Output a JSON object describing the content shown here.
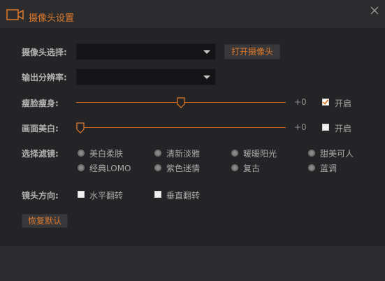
{
  "window": {
    "title": "摄像头设置",
    "accent": "#e07a2c",
    "icons": {
      "camera": "video-camera-icon",
      "close": "close-icon"
    }
  },
  "camera_select": {
    "label": "摄像头选择:",
    "value": "",
    "open_button": "打开摄像头"
  },
  "resolution": {
    "label": "输出分辨率:",
    "value": ""
  },
  "slim_face": {
    "label": "瘦脸瘦身:",
    "value_text": "+0",
    "level": 0.5,
    "enable_label": "开启",
    "enabled": true
  },
  "whitening": {
    "label": "画面美白:",
    "value_text": "+0",
    "level": 0.0,
    "enable_label": "开启",
    "enabled": false
  },
  "filters": {
    "label": "选择滤镜:",
    "options": [
      "美白柔肤",
      "清新淡雅",
      "暖暖阳光",
      "甜美可人",
      "经典LOMO",
      "紫色迷情",
      "复古",
      "蓝调"
    ]
  },
  "lens": {
    "label": "镜头方向:",
    "horizontal": "水平翻转",
    "vertical": "垂直翻转"
  },
  "reset_button": "恢复默认"
}
